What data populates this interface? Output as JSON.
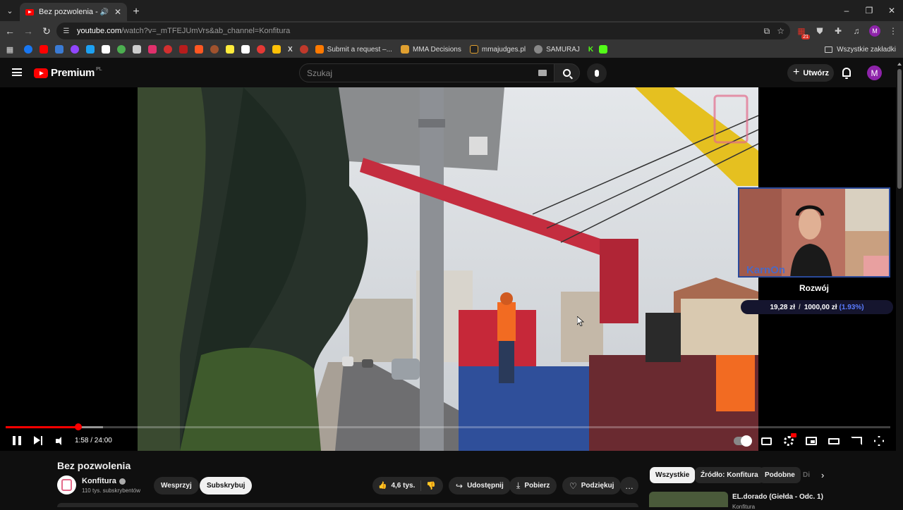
{
  "browser": {
    "tab_title": "Bez pozwolenia - YouTube",
    "url_host": "youtube.com",
    "url_rest": "/watch?v=_mTFEJUmVrs&ab_channel=Konfitura",
    "extension_badge": "21",
    "profile_initial": "M",
    "bookmarks": [
      {
        "label": "Submit a request –...",
        "color": "#ff7a00"
      },
      {
        "label": "MMA Decisions",
        "color": "#e0a030"
      },
      {
        "label": "mmajudges.pl",
        "color": "#222222"
      },
      {
        "label": "SAMURAJ",
        "color": "#888888"
      }
    ],
    "bookmark_icons": [
      "#1877f2",
      "#ff0000",
      "#3a7bd5",
      "#9146ff",
      "#1da1f2",
      "#ffffff",
      "#4caf50",
      "#cccccc",
      "#e1306c",
      "#d32f2f",
      "#b71c1c",
      "#ff5722",
      "#a0522d",
      "#ffeb3b",
      "#ffffff",
      "#e53935",
      "#ffc107"
    ],
    "x_label": "X",
    "k_label": "K",
    "bookmarks_folder": "Wszystkie zakładki"
  },
  "youtube": {
    "logo_word": "Premium",
    "region": "PL",
    "search_placeholder": "Szukaj",
    "create_label": "Utwórz",
    "avatar_initial": "M"
  },
  "player": {
    "timecode": "1:58 / 24:00",
    "played_fraction": 0.0825,
    "buffered_fraction": 0.11,
    "overlay_name": "KarnOn",
    "goal_title": "Rozwój",
    "goal_current": "19,28 zł",
    "goal_separator": "/",
    "goal_target": "1000,00 zł",
    "goal_percent": "(1.93%)"
  },
  "video_info": {
    "title": "Bez pozwolenia",
    "channel": "Konfitura",
    "subscribers": "110 tys. subskrybentów",
    "support_label": "Wesprzyj",
    "subscribe_label": "Subskrybuj",
    "likes": "4,6 tys.",
    "share_label": "Udostępnij",
    "download_label": "Pobierz",
    "thanks_label": "Podziękuj",
    "more_label": "…"
  },
  "recommendations": {
    "chips": [
      "Wszystkie",
      "Źródło: Konfitura",
      "Podobne",
      "Di"
    ],
    "first_title": "EL.dorado (Giełda - Odc. 1)",
    "first_channel": "Konfitura"
  }
}
